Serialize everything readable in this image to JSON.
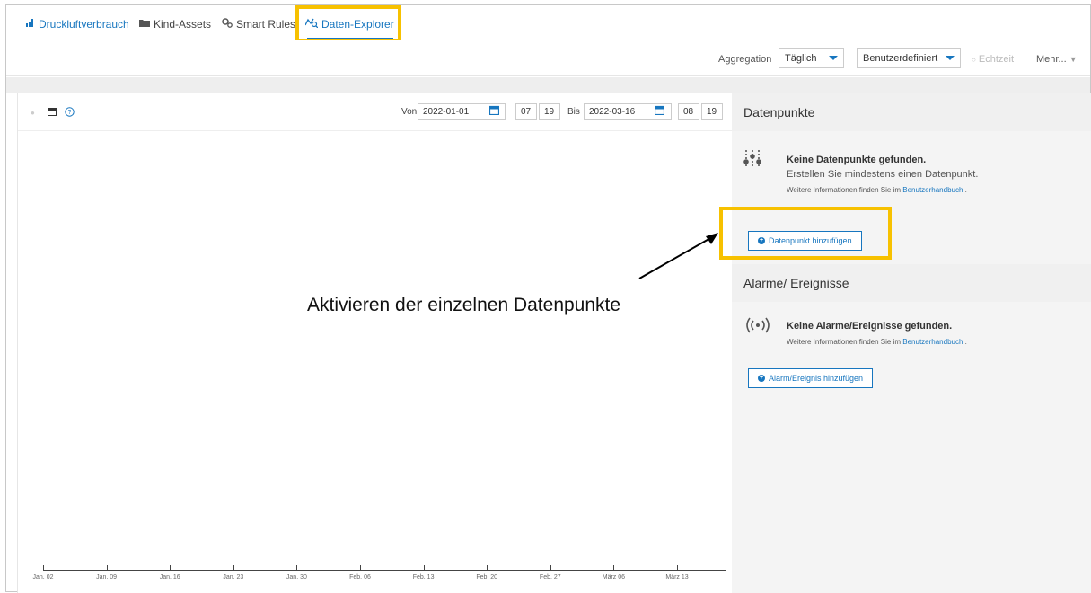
{
  "tabs": [
    {
      "label": "Druckluftverbrauch",
      "icon": "bar-chart-icon"
    },
    {
      "label": "Kind-Assets",
      "icon": "folder-icon"
    },
    {
      "label": "Smart Rules",
      "icon": "gears-icon"
    },
    {
      "label": "Daten-Explorer",
      "icon": "data-explorer-icon",
      "active": true
    }
  ],
  "toolbar": {
    "aggregation_label": "Aggregation",
    "aggregation_value": "Täglich",
    "range_value": "Benutzerdefiniert",
    "realtime_label": "Echtzeit",
    "more_label": "Mehr..."
  },
  "range": {
    "from_label": "Von",
    "from_date": "2022-01-01",
    "from_hour": "07",
    "from_min": "19",
    "to_label": "Bis",
    "to_date": "2022-03-16",
    "to_hour": "08",
    "to_min": "19"
  },
  "chart_data": {
    "type": "line",
    "x_ticks": [
      "Jan. 02",
      "Jan. 09",
      "Jan. 16",
      "Jan. 23",
      "Jan. 30",
      "Feb. 06",
      "Feb. 13",
      "Feb. 20",
      "Feb. 27",
      "März 06",
      "März 13"
    ],
    "series": []
  },
  "datapoints": {
    "title": "Datenpunkte",
    "empty_title": "Keine Datenpunkte gefunden.",
    "empty_text": "Erstellen Sie mindestens einen Datenpunkt.",
    "info_prefix": "Weitere Informationen finden Sie im",
    "info_link": "Benutzerhandbuch",
    "info_suffix": ".",
    "add_button": "Datenpunkt hinzufügen"
  },
  "alarms": {
    "title": "Alarme/ Ereignisse",
    "empty_title": "Keine Alarme/Ereignisse gefunden.",
    "info_prefix": "Weitere Informationen finden Sie im",
    "info_link": "Benutzerhandbuch",
    "info_suffix": ".",
    "add_button": "Alarm/Ereignis hinzufügen"
  },
  "annotation": {
    "text": "Aktivieren der einzelnen Datenpunkte"
  },
  "colors": {
    "accent": "#1776bf",
    "highlight": "#f7c100"
  }
}
